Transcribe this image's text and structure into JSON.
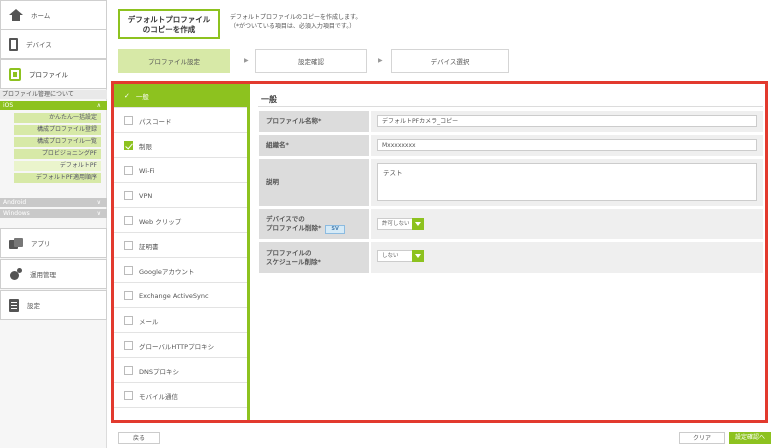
{
  "colors": {
    "accent": "#8dc21f",
    "highlight_border": "#e23a2e",
    "label_bg": "#dcdcdc"
  },
  "sidebar": {
    "home": "ホーム",
    "device": "デバイス",
    "profile": "プロファイル",
    "profile_about": "プロファイル管理について",
    "ios": {
      "label": "iOS",
      "chevron": "∧"
    },
    "ios_items": [
      "かんたん一括設定",
      "構成プロファイル登録",
      "構成プロファイル一覧",
      "プロビジョニングPF",
      "デフォルトPF",
      "デフォルトPF適用順序"
    ],
    "android": "Android",
    "windows": "Windows",
    "os_chevron": "∨",
    "app": "アプリ",
    "operation": "運用管理",
    "settings": "設定"
  },
  "header": {
    "title": "デフォルトプロファイル\nのコピーを作成",
    "description": "デフォルトプロファイルのコピーを作成します。\n（*がついている項目は、必須入力項目です。）"
  },
  "steps": [
    "プロファイル設定",
    "設定確認",
    "デバイス選択"
  ],
  "step_arrow": "▶",
  "left_menu": [
    {
      "label": "一般",
      "checked": true,
      "selected": true,
      "mark": "✓"
    },
    {
      "label": "パスコード",
      "checked": false
    },
    {
      "label": "制限",
      "checked": true
    },
    {
      "label": "Wi-Fi",
      "checked": false
    },
    {
      "label": "VPN",
      "checked": false
    },
    {
      "label": "Web クリップ",
      "checked": false
    },
    {
      "label": "証明書",
      "checked": false
    },
    {
      "label": "Googleアカウント",
      "checked": false
    },
    {
      "label": "Exchange ActiveSync",
      "checked": false
    },
    {
      "label": "メール",
      "checked": false
    },
    {
      "label": "グローバルHTTPプロキシ",
      "checked": false
    },
    {
      "label": "DNSプロキシ",
      "checked": false
    },
    {
      "label": "モバイル通信",
      "checked": false
    }
  ],
  "form": {
    "title": "一般",
    "profile_name_label": "プロファイル名称*",
    "profile_name_value": "デフォルトPFカメラ_コピー",
    "org_label": "組織名*",
    "org_value": "Mxxxxxxxx",
    "desc_label": "説明",
    "desc_value": "テスト",
    "device_delete_label1": "デバイスでの",
    "device_delete_label2": "プロファイル削除*",
    "device_delete_badge": "SV",
    "device_delete_value": "許可しない",
    "schedule_label1": "プロファイルの",
    "schedule_label2": "スケジュール削除*",
    "schedule_value": "しない"
  },
  "footer": {
    "back": "戻る",
    "clear": "クリア",
    "next": "設定確認へ"
  }
}
